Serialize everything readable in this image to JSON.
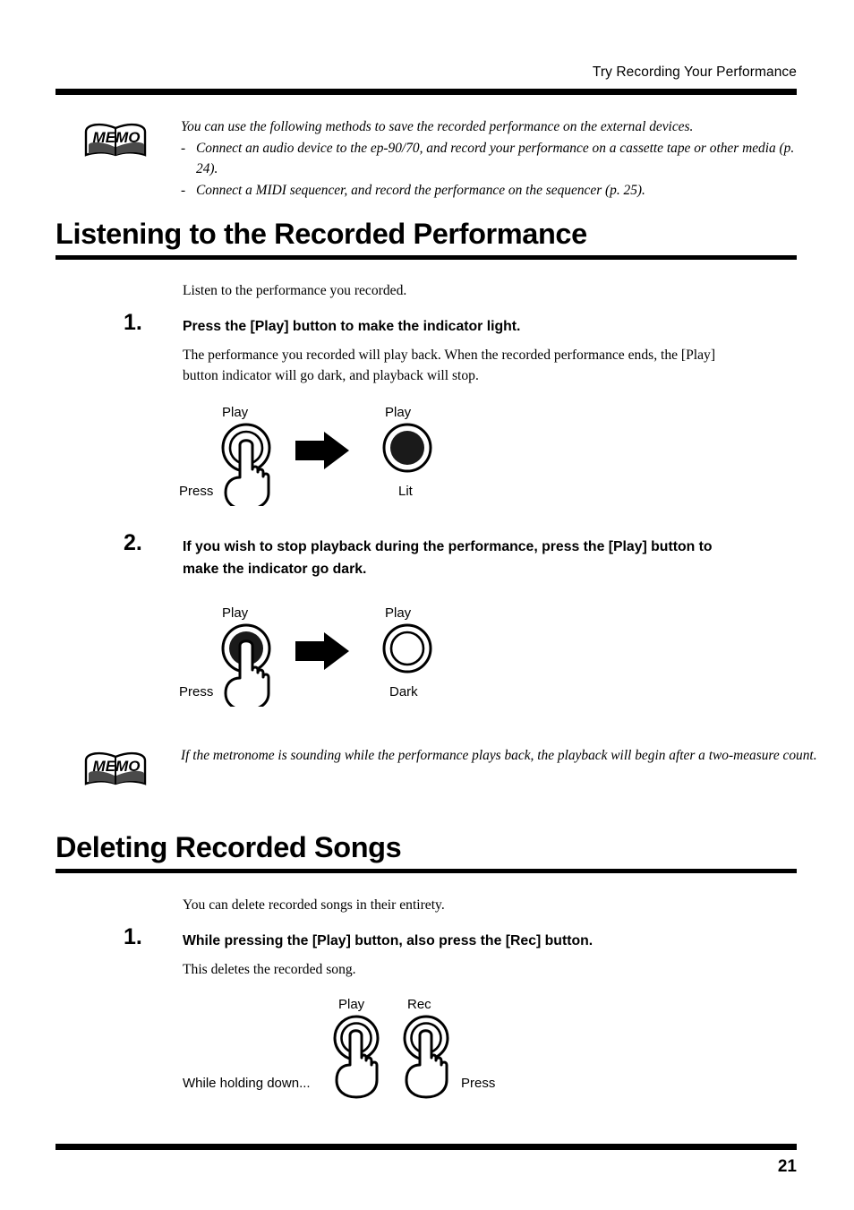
{
  "header": {
    "running_title": "Try Recording Your Performance"
  },
  "memo1": {
    "icon_label": "MEMO",
    "intro": "You can use the following methods to save the recorded performance on the external devices.",
    "bullets": [
      "Connect an audio device to the ep-90/70, and record your performance on a cassette tape or other media (p. 24).",
      "Connect a MIDI sequencer, and record the performance on the sequencer (p. 25)."
    ],
    "dash": "-"
  },
  "section1": {
    "title": "Listening to the Recorded Performance",
    "intro": "Listen to the performance you recorded.",
    "step1": {
      "number": "1.",
      "heading": "Press the [Play] button to make the indicator light.",
      "body": "The performance you recorded will play back. When the recorded performance ends, the [Play] button indicator will go dark, and playback will stop."
    },
    "figure1": {
      "left_button_label": "Play",
      "left_action_label": "Press",
      "right_button_label": "Play",
      "right_state_label": "Lit"
    },
    "step2": {
      "number": "2.",
      "heading": "If you wish to stop playback during the performance, press the [Play] button to make the indicator go dark."
    },
    "figure2": {
      "left_button_label": "Play",
      "left_action_label": "Press",
      "right_button_label": "Play",
      "right_state_label": "Dark"
    }
  },
  "memo2": {
    "icon_label": "MEMO",
    "text": "If the metronome is sounding while the performance plays back, the playback will begin after a two-measure count."
  },
  "section2": {
    "title": "Deleting Recorded Songs",
    "intro": "You can delete recorded songs in their entirety.",
    "step1": {
      "number": "1.",
      "heading": "While pressing the [Play] button, also press the [Rec] button.",
      "body": "This deletes the recorded song."
    },
    "figure3": {
      "hold_label": "While holding down...",
      "play_button_label": "Play",
      "rec_button_label": "Rec",
      "press_label": "Press"
    }
  },
  "footer": {
    "page_number": "21"
  },
  "colors": {
    "ink": "#000000",
    "paper": "#ffffff"
  }
}
